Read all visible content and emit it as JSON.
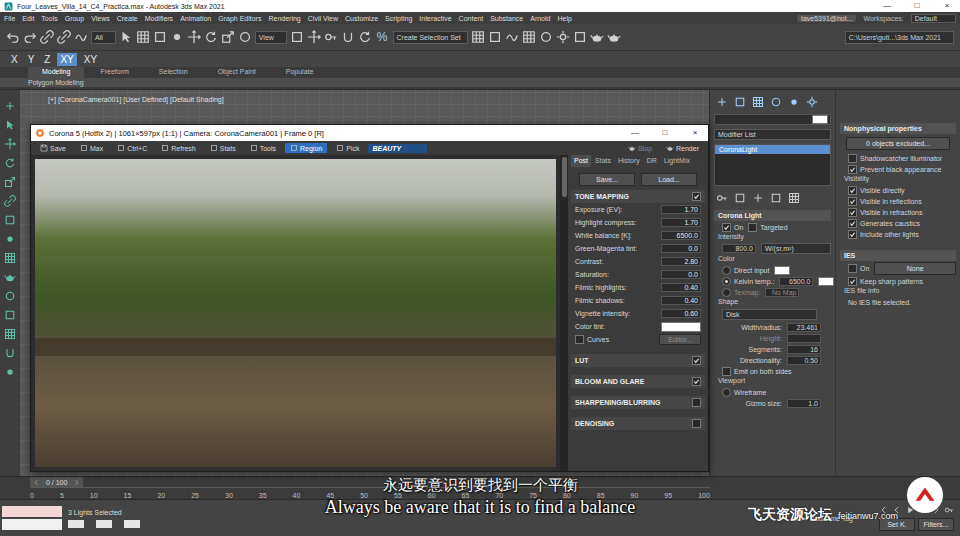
{
  "window": {
    "title": "Four_Leaves_Villa_14_C4_Practica.max - Autodesk 3ds Max 2021",
    "controls": [
      "—",
      "□",
      "×"
    ]
  },
  "menu": [
    "File",
    "Edit",
    "Tools",
    "Group",
    "Views",
    "Create",
    "Modifiers",
    "Animation",
    "Graph Editors",
    "Rendering",
    "Civil View",
    "Customize",
    "Scripting",
    "Interactive",
    "Content",
    "Substance",
    "Arnold",
    "Help"
  ],
  "account": {
    "user": "tave5391@hot...",
    "workspaces_label": "Workspaces:",
    "workspace": "Default"
  },
  "toolbar": {
    "filter": "All",
    "ref_coord": "View",
    "percent_snap": "%",
    "selection_set": "Create Selection Set",
    "project_path": "C:\\Users\\guti...\\3ds Max 2021"
  },
  "axis_buttons": [
    {
      "label": "X",
      "selected": false
    },
    {
      "label": "Y",
      "selected": false
    },
    {
      "label": "Z",
      "selected": false
    },
    {
      "label": "XY",
      "selected": true
    },
    {
      "label": "XY",
      "selected": false
    }
  ],
  "ribbon": {
    "tabs": [
      {
        "label": "Modeling",
        "selected": true
      },
      {
        "label": "Freeform",
        "selected": false
      },
      {
        "label": "Selection",
        "selected": false
      },
      {
        "label": "Object Paint",
        "selected": false
      },
      {
        "label": "Populate",
        "selected": false
      }
    ],
    "panel": "Polygon Modeling"
  },
  "viewport": {
    "label": "[+] [CoronaCamera001] [User Defined] [Default Shading]"
  },
  "frame_buffer": {
    "title": "Corona 5 (Hotfix 2) | 1061×597px (1:1) | Camera: CoronaCamera001 | Frame 0 [R]",
    "controls": [
      "—",
      "□",
      "×"
    ],
    "toolbar": [
      {
        "label": "Save",
        "selected": false
      },
      {
        "label": "Max",
        "selected": false
      },
      {
        "label": "Ctrl+C",
        "selected": false
      },
      {
        "label": "Refresh",
        "selected": false
      },
      {
        "label": "Stats",
        "selected": false
      },
      {
        "label": "Tools",
        "selected": false
      },
      {
        "label": "Region",
        "selected": true
      },
      {
        "label": "Pick",
        "selected": false
      }
    ],
    "channel": "BEAUTY",
    "render_buttons": [
      {
        "label": "Stop",
        "disabled": true
      },
      {
        "label": "Render",
        "disabled": false
      }
    ],
    "panel_tabs": [
      {
        "label": "Post",
        "selected": true
      },
      {
        "label": "Stats",
        "selected": false
      },
      {
        "label": "History",
        "selected": false
      },
      {
        "label": "DR",
        "selected": false
      },
      {
        "label": "LightMix",
        "selected": false
      }
    ],
    "file_buttons": [
      "Save...",
      "Load..."
    ],
    "tone_mapping": {
      "title": "TONE MAPPING",
      "checked": true,
      "rows": [
        {
          "label": "Exposure (EV):",
          "value": "1.70"
        },
        {
          "label": "Highlight compress:",
          "value": "1.70"
        },
        {
          "label": "White balance [K]:",
          "value": "6500.0"
        },
        {
          "label": "Green-Magenta tint:",
          "value": "0.0"
        },
        {
          "label": "Contrast:",
          "value": "2.80"
        },
        {
          "label": "Saturation:",
          "value": "0.0"
        },
        {
          "label": "Filmic highlights:",
          "value": "0.40"
        },
        {
          "label": "Filmic shadows:",
          "value": "0.40"
        },
        {
          "label": "Vignette intensity:",
          "value": "0.60"
        }
      ],
      "color_tint": "Color tint:",
      "curves": {
        "label": "Curves",
        "checked": false,
        "button": "Editor..."
      }
    },
    "sections": [
      {
        "title": "LUT",
        "checked": true
      },
      {
        "title": "BLOOM AND GLARE",
        "checked": true
      },
      {
        "title": "SHARPENING/BLURRING",
        "checked": false
      },
      {
        "title": "DENOISING",
        "checked": false
      }
    ]
  },
  "command_panel": {
    "modifier_list": "Modifier List",
    "stack": [
      {
        "label": "CoronaLight",
        "selected": true
      }
    ],
    "rollout_title": "Corona Light",
    "on": {
      "label": "On",
      "checked": true
    },
    "targeted": {
      "label": "Targeted",
      "checked": false
    },
    "intensity": {
      "label": "Intensity",
      "value": "800.0",
      "units": "W/(sr.m²)"
    },
    "color": {
      "label": "Color",
      "options": [
        {
          "label": "Direct input",
          "selected": false,
          "value": ""
        },
        {
          "label": "Kelvin temp.:",
          "selected": true,
          "value": "6500.0"
        },
        {
          "label": "Texmap:",
          "selected": false,
          "value": "No Map"
        }
      ]
    },
    "shape": {
      "label": "Shape",
      "type": "Disk",
      "fields": [
        {
          "label": "Width/radius:",
          "value": "23.461",
          "disabled": false
        },
        {
          "label": "Height:",
          "value": "",
          "disabled": true
        },
        {
          "label": "Segments:",
          "value": "16",
          "disabled": false
        },
        {
          "label": "Directionality:",
          "value": "0.50",
          "disabled": false
        }
      ],
      "emit_both": {
        "label": "Emit on both sides",
        "checked": false
      }
    },
    "viewport": {
      "label": "Viewport",
      "wireframe": {
        "label": "Wireframe",
        "selected": false
      },
      "gizmo": {
        "label": "Gizmo size:",
        "value": "1.0"
      }
    }
  },
  "properties": {
    "title": "Nonphysical properties",
    "exclude_button": "0 objects excluded...",
    "items": [
      {
        "kind": "check",
        "label": "Shadowcatcher illuminator",
        "checked": false
      },
      {
        "kind": "check",
        "label": "Prevent black appearance",
        "checked": true
      },
      {
        "kind": "heading",
        "label": "Visibility",
        "checked": false
      },
      {
        "kind": "check",
        "label": "Visible directly",
        "checked": true
      },
      {
        "kind": "check",
        "label": "Visible in reflections",
        "checked": true
      },
      {
        "kind": "check",
        "label": "Visible in refractions",
        "checked": true
      },
      {
        "kind": "check",
        "label": "Generates caustics",
        "checked": true
      },
      {
        "kind": "check",
        "label": "Include other lights",
        "checked": true
      }
    ]
  },
  "ies": {
    "title": "IES",
    "on": {
      "label": "On",
      "checked": false
    },
    "file_button": "None",
    "keep_sharp": {
      "label": "Keep sharp patterns",
      "checked": true
    },
    "info_label": "IES file info",
    "info": "No IES file selected."
  },
  "timeline": {
    "frame": "0 / 100",
    "ticks": [
      "0",
      "5",
      "10",
      "15",
      "20",
      "25",
      "30",
      "35",
      "40",
      "45",
      "50",
      "55",
      "60",
      "65",
      "70",
      "75",
      "80",
      "85",
      "90",
      "95",
      "100"
    ]
  },
  "status": {
    "selection": "3 Lights Selected",
    "time_tag": "Add Time Tag",
    "key_buttons": [
      "Set K.",
      "Filters..."
    ]
  },
  "subtitles": {
    "zh": "永远要意识到要找到一个平衡",
    "en": "Always be aware that it is to find a balance"
  },
  "watermark": {
    "site": "飞天资源论坛",
    "url": "feitianwu7.com"
  }
}
